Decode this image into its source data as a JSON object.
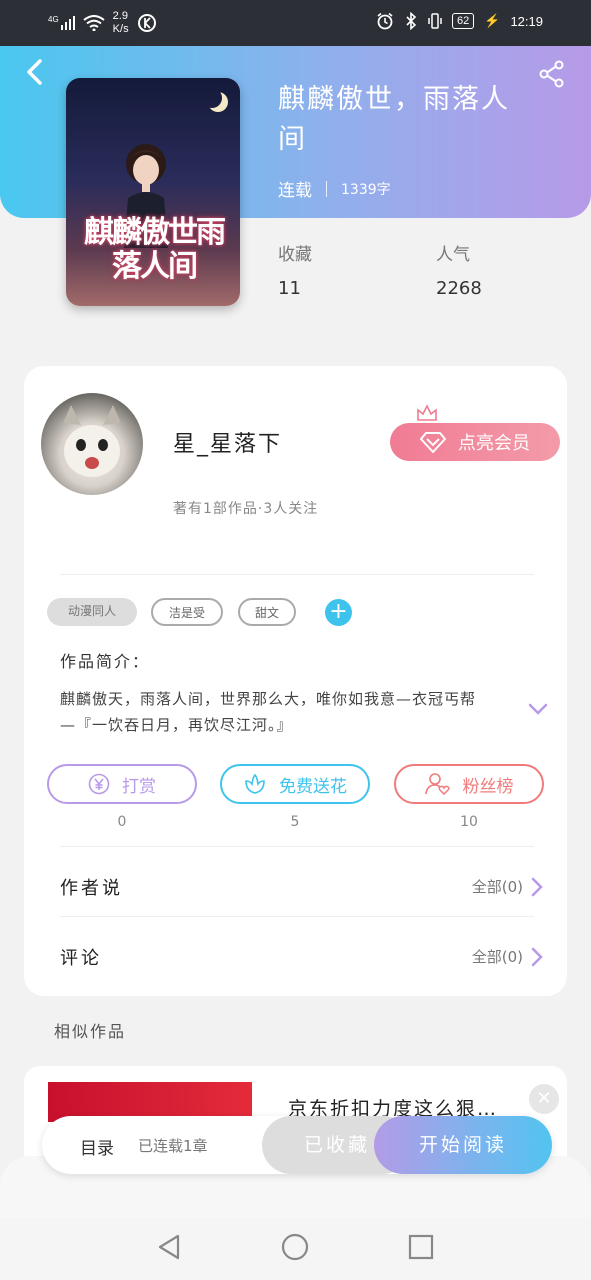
{
  "status_bar": {
    "signal": "4G",
    "speed_value": "2.9",
    "speed_unit": "K/s",
    "battery": "62",
    "time": "12:19"
  },
  "book": {
    "title": "麒麟傲世，雨落人间",
    "cover_title": "麒麟傲世雨落人间",
    "status": "连载",
    "word_count": "1339字",
    "favorites_label": "收藏",
    "favorites_value": "11",
    "popularity_label": "人气",
    "popularity_value": "2268"
  },
  "author": {
    "name": "星_星落下",
    "stats": "著有1部作品·3人关注",
    "vip_button": "点亮会员"
  },
  "tags": [
    "动漫同人",
    "洁是受",
    "甜文"
  ],
  "intro": {
    "label": "作品简介：",
    "text": "麒麟傲天，雨落人间，世界那么大，唯你如我意—衣冠丐帮—『一饮吞日月，再饮尽江河。』"
  },
  "actions": [
    {
      "label": "打赏",
      "count": "0",
      "icon": "yen-icon",
      "color": "#b79ae8"
    },
    {
      "label": "免费送花",
      "count": "5",
      "icon": "flower-icon",
      "color": "#3ec3ec"
    },
    {
      "label": "粉丝榜",
      "count": "10",
      "icon": "fans-icon",
      "color": "#f07b7b"
    }
  ],
  "rows": [
    {
      "label": "作者说",
      "right": "全部(0)"
    },
    {
      "label": "评论",
      "right": "全部(0)"
    }
  ],
  "similar": {
    "label": "相似作品",
    "ad_text": "京东折扣力度这么狠…"
  },
  "bottom_bar": {
    "toc": "目录",
    "toc_sub": "已连载1章",
    "collected": "已收藏",
    "read": "开始阅读"
  }
}
